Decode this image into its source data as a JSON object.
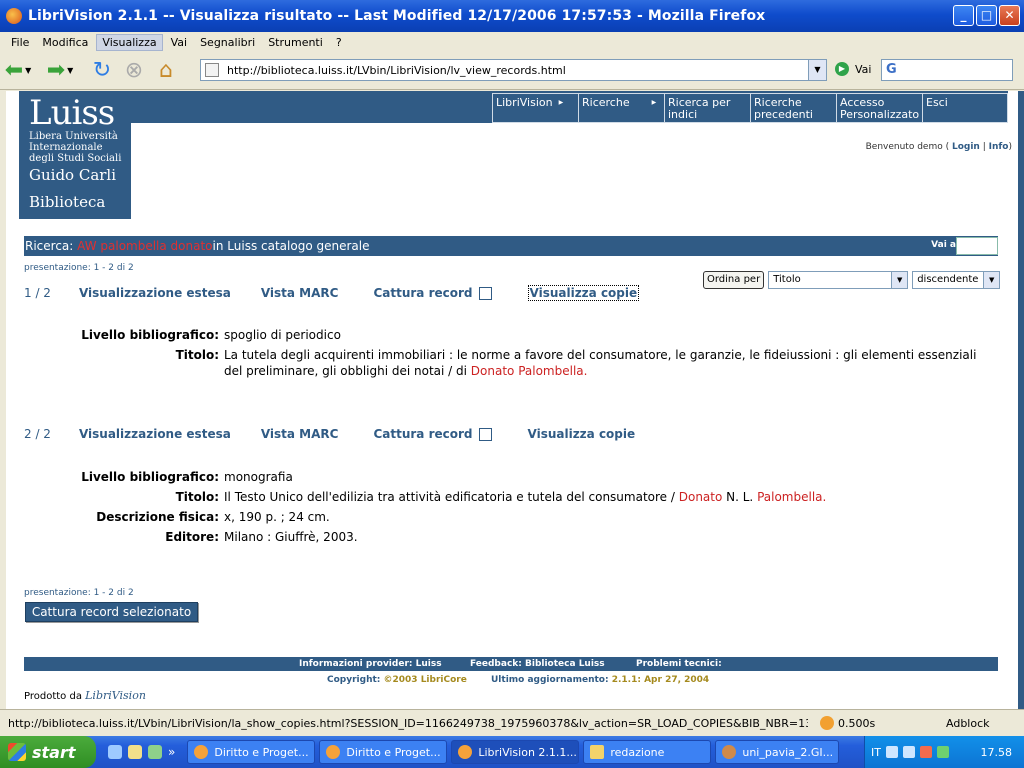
{
  "window": {
    "title": "LibriVision 2.1.1 -- Visualizza risultato -- Last Modified 12/17/2006 17:57:53 - Mozilla Firefox"
  },
  "menu": [
    {
      "label": "File",
      "accel": "F"
    },
    {
      "label": "Modifica",
      "accel": "M"
    },
    {
      "label": "Visualizza",
      "accel": "V"
    },
    {
      "label": "Vai",
      "accel": "a"
    },
    {
      "label": "Segnalibri",
      "accel": "g"
    },
    {
      "label": "Strumenti",
      "accel": "S"
    },
    {
      "label": "?",
      "accel": "?"
    }
  ],
  "toolbar": {
    "url": "http://biblioteca.luiss.it/LVbin/LibriVision/lv_view_records.html",
    "go_label": "Vai",
    "search_placeholder": "G"
  },
  "logo": {
    "name": "Luiss",
    "line1": "Libera Università",
    "line2": "Internazionale",
    "line3": "degli Studi Sociali",
    "line4": "Guido Carli",
    "section": "Biblioteca"
  },
  "nav": [
    {
      "label": "LibriVision",
      "has_arrow": true
    },
    {
      "label": "Ricerche",
      "has_arrow": true
    },
    {
      "label": "Ricerca per indici",
      "has_arrow": false
    },
    {
      "label": "Ricerche precedenti",
      "has_arrow": false
    },
    {
      "label": "Accesso Personalizzato",
      "has_arrow": false
    },
    {
      "label": "Esci",
      "has_arrow": false
    }
  ],
  "welcome": {
    "prefix": "Benvenuto demo (",
    "login": "Login",
    "sep": "|",
    "info": "Info",
    "suffix": ")"
  },
  "search": {
    "prefix": "Ricerca: ",
    "query": "AW palombella donato",
    "suffix": " in Luiss catalogo generale",
    "vai_a": "Vai a"
  },
  "presentation": "presentazione: 1 - 2 di 2",
  "sort": {
    "button": "Ordina per",
    "field": "Titolo",
    "order": "discendente"
  },
  "record_links": {
    "estesa": "Visualizzazione estesa",
    "marc": "Vista MARC",
    "cattura": "Cattura record",
    "copie": "Visualizza copie"
  },
  "records": [
    {
      "num": "1 / 2",
      "fields": [
        {
          "label": "Livello bibliografico:",
          "value": "spoglio di periodico"
        },
        {
          "label": "Titolo:",
          "value": "La tutela degli acquirenti immobiliari : le norme a favore del consumatore, le garanzie, le fideiussioni : gli elementi essenziali del preliminare, gli obblighi dei notai / di ",
          "highlight": "Donato Palombella."
        }
      ]
    },
    {
      "num": "2 / 2",
      "fields": [
        {
          "label": "Livello bibliografico:",
          "value": "monografia"
        },
        {
          "label": "Titolo:",
          "value": "Il Testo Unico dell'edilizia tra attività edificatoria e tutela del consumatore / ",
          "highlight": "Donato",
          "mid": " N. L. ",
          "highlight2": "Palombella."
        },
        {
          "label": "Descrizione fisica:",
          "value": "x, 190 p. ; 24 cm."
        },
        {
          "label": "Editore:",
          "value": "Milano : Giuffrè, 2003."
        }
      ]
    }
  ],
  "cattura_button": "Cattura record selezionato",
  "footer": {
    "provider": "Informazioni provider: Luiss",
    "feedback": "Feedback: Biblioteca Luiss",
    "problemi": "Problemi tecnici:",
    "copyright_label": "Copyright: ",
    "copyright_value": "©2003 LibriCore",
    "updated_label": "Ultimo aggiornamento: ",
    "updated_value": "2.1.1: Apr 27, 2004",
    "prodotto": "Prodotto da ",
    "prodotto_brand": "LibriVision"
  },
  "status": {
    "url": "http://biblioteca.luiss.it/LVbin/LibriVision/la_show_copies.html?SESSION_ID=1166249738_1975960378&lv_action=SR_LOAD_COPIES&BIB_NBR=1363163&ALL_C...",
    "time": "0.500s",
    "adblock": "Adblock"
  },
  "taskbar": {
    "start": "start",
    "tasks": [
      {
        "label": "Diritto e Proget...",
        "icon": "firefox-icon",
        "active": false
      },
      {
        "label": "Diritto e Proget...",
        "icon": "firefox-icon",
        "active": false
      },
      {
        "label": "LibriVision 2.1.1...",
        "icon": "firefox-icon",
        "active": true
      },
      {
        "label": "redazione",
        "icon": "folder-icon",
        "active": false
      },
      {
        "label": "uni_pavia_2.GI...",
        "icon": "image-icon",
        "active": false
      }
    ],
    "lang": "IT",
    "clock": "17.58"
  },
  "colors": {
    "brand_blue": "#305b85",
    "highlight_red": "#cc2222"
  }
}
